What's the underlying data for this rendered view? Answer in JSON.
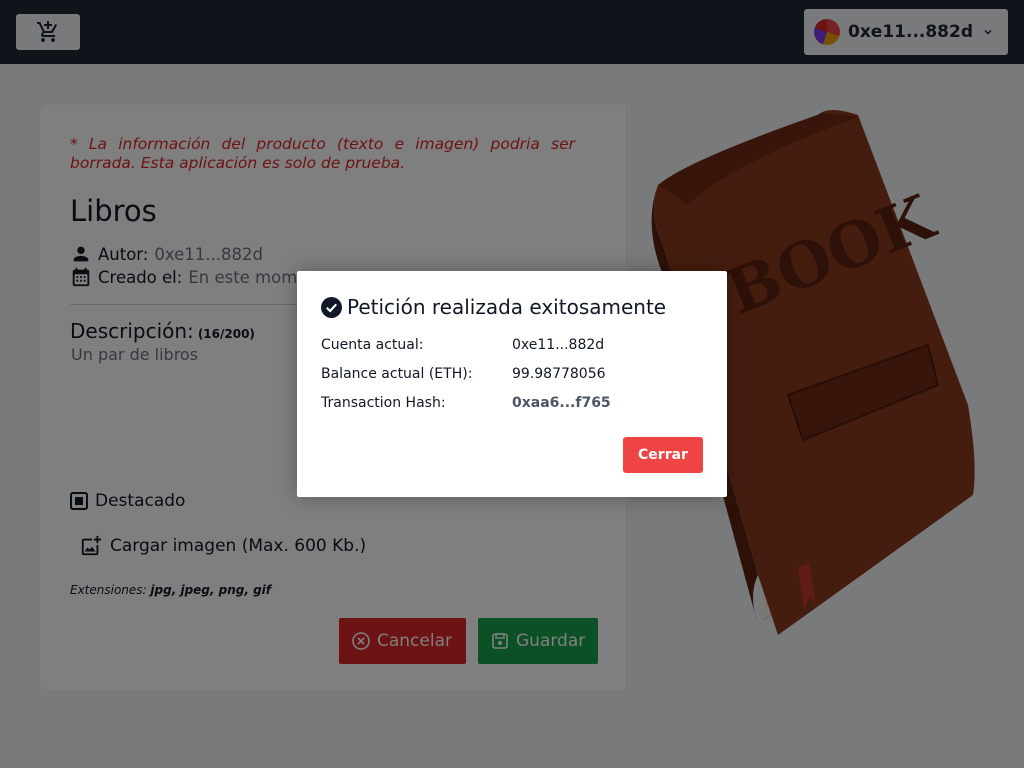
{
  "header": {
    "account_label": "0xe11...882d"
  },
  "product": {
    "warning": "* La información del producto (texto e imagen) podria ser borrada. Esta aplicación es solo de prueba.",
    "title": "Libros",
    "author_label": "Autor:",
    "author_value": "0xe11...882d",
    "created_label": "Creado el:",
    "created_value": "En este momento",
    "description_label": "Descripción:",
    "description_count": "(16/200)",
    "description_text": "Un par de libros",
    "featured_label": "Destacado",
    "upload_label": "Cargar imagen (Max. 600 Kb.)",
    "extensions_label": "Extensiones:",
    "extensions_value": "jpg, jpeg, png, gif",
    "cancel_label": "Cancelar",
    "save_label": "Guardar",
    "image_text": "BOOK"
  },
  "modal": {
    "title": "Petición realizada exitosamente",
    "rows": [
      {
        "label": "Cuenta actual:",
        "value": "0xe11...882d"
      },
      {
        "label": "Balance actual (ETH):",
        "value": "99.98778056"
      },
      {
        "label": "Transaction Hash:",
        "value": "0xaa6...f765"
      }
    ],
    "close_label": "Cerrar"
  },
  "colors": {
    "header_bg": "#1f2937",
    "danger": "#dc2626",
    "success": "#16a34a",
    "close_button": "#ef4444"
  }
}
